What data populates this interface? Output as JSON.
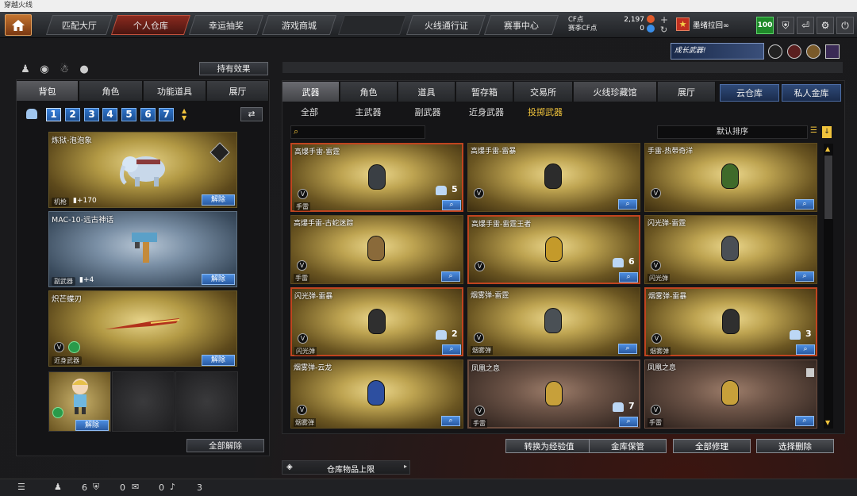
{
  "window_title": "穿越火线",
  "topbar": {
    "tabs": [
      "匹配大厅",
      "个人仓库",
      "幸运抽奖",
      "游戏商城"
    ],
    "right_tabs": [
      "火线通行证",
      "赛事中心"
    ],
    "cf_label": "CF点",
    "cf_value": "2,197",
    "season_cf_label": "赛季CF点",
    "season_cf_value": "0",
    "username": "墨绪拉回∞",
    "level_badge": "100"
  },
  "left": {
    "hold_effect_button": "持有效果",
    "tabs": [
      "背包",
      "角色",
      "功能道具",
      "展厅"
    ],
    "pages": [
      "1",
      "2",
      "3",
      "4",
      "5",
      "6",
      "7"
    ],
    "cards": [
      {
        "name": "炼狱-泡泡象",
        "tag": "机枪",
        "bonus": "+170",
        "release": "解除"
      },
      {
        "name": "MAC-10-远古神话",
        "tag": "副武器",
        "bonus": "+4",
        "release": "解除"
      },
      {
        "name": "炽芒蝶刃",
        "tag": "近身武器",
        "release": "解除"
      }
    ],
    "char_release": "解除",
    "release_all": "全部解除"
  },
  "right": {
    "tabs": [
      "武器",
      "角色",
      "道具",
      "暂存箱",
      "交易所",
      "火线珍藏馆",
      "展厅"
    ],
    "blue_tabs": [
      "云仓库",
      "私人金库"
    ],
    "sub_tabs": [
      "全部",
      "主武器",
      "副武器",
      "近身武器",
      "投掷武器"
    ],
    "sort_label": "默认排序",
    "items": [
      {
        "name": "高爆手雷-雷霆",
        "tag": "手雷",
        "count": "5",
        "selected": true,
        "dark": false,
        "color": "#3a3f44"
      },
      {
        "name": "高爆手雷-雷暴",
        "tag": "",
        "count": "",
        "selected": false,
        "dark": false,
        "color": "#2c2c2c"
      },
      {
        "name": "手雷-热带奇洋",
        "tag": "",
        "count": "",
        "selected": false,
        "dark": false,
        "color": "#3f6a2a"
      },
      {
        "name": "高爆手雷-古蛇迷踪",
        "tag": "手雷",
        "count": "",
        "selected": false,
        "dark": false,
        "color": "#8a6a3a"
      },
      {
        "name": "高爆手雷-雷霆王者",
        "tag": "",
        "count": "6",
        "selected": true,
        "dark": false,
        "color": "#c49a2a"
      },
      {
        "name": "闪光弹-雷霆",
        "tag": "闪光弹",
        "count": "",
        "selected": false,
        "dark": false,
        "color": "#4a4f55"
      },
      {
        "name": "闪光弹-雷暴",
        "tag": "闪光弹",
        "count": "2",
        "selected": true,
        "dark": false,
        "color": "#2f2f2f"
      },
      {
        "name": "烟雾弹-雷霆",
        "tag": "烟雾弹",
        "count": "",
        "selected": false,
        "dark": false,
        "color": "#4a5055"
      },
      {
        "name": "烟雾弹-雷暴",
        "tag": "烟雾弹",
        "count": "3",
        "selected": true,
        "dark": false,
        "color": "#2f2f2f"
      },
      {
        "name": "烟雾弹-云龙",
        "tag": "烟雾弹",
        "count": "",
        "selected": false,
        "dark": false,
        "color": "#2d4fa0"
      },
      {
        "name": "凤凰之息",
        "tag": "手雷",
        "count": "7",
        "selected": true,
        "dark": true,
        "color": "#c7a03a"
      },
      {
        "name": "凤凰之息",
        "tag": "手雷",
        "count": "",
        "selected": false,
        "dark": true,
        "color": "#c7a03a"
      }
    ],
    "actions": [
      "转换为经验值",
      "金库保管",
      "全部修理",
      "选择删除"
    ],
    "capacity_label": "仓库物品上限"
  },
  "status": {
    "count1": "6",
    "count2": "0",
    "count3": "0",
    "count4": "3"
  }
}
